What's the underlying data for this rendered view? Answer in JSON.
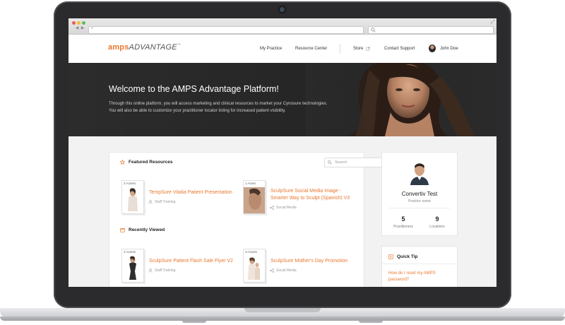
{
  "browser": {
    "url_value": "",
    "search_value": "",
    "back": "◀",
    "forward": "▶",
    "expand": "⤢"
  },
  "logo": {
    "brand": "amps",
    "product": "ADVANTAGE",
    "tm": "™"
  },
  "nav": {
    "my_practice": "My Practice",
    "resource_center": "Resource Center",
    "store": "Store",
    "store_icon": "external-link-icon",
    "contact_support": "Contact Support",
    "user_name": "John Doe"
  },
  "hero": {
    "title": "Welcome to the AMPS Advantage Platform!",
    "text": "Through this online platform, you will access marketing and clinical resources to market your Cynosure technologies. You will also be able to customize your practitioner locator listing for increased patient visibility."
  },
  "featured": {
    "title": "Featured Resources",
    "search_placeholder": "Search",
    "items": [
      {
        "count": "3 Assets",
        "title": "TempSure Vitalia Patient Presentation",
        "meta": "Staff Training",
        "meta_icon": "user-icon"
      },
      {
        "count": "1 Asset",
        "title": "SculpSure Social Media Image - Smarter Way to Sculpt (Spanish) V3",
        "meta": "Social Media",
        "meta_icon": "share-icon"
      }
    ]
  },
  "recent": {
    "title": "Recently Viewed",
    "items": [
      {
        "count": "3 Assets",
        "title": "SculpSure Patient Flash Sale Flyer V2",
        "meta": "Staff Training",
        "meta_icon": "user-icon"
      },
      {
        "count": "3 Assets",
        "title": "SculpSure Mother's Day Promotion",
        "meta": "Social Media",
        "meta_icon": "share-icon"
      }
    ]
  },
  "profile": {
    "name": "Convertiv Test",
    "subtitle": "Practice name",
    "practitioners_count": "5",
    "practitioners_label": "Practitioners",
    "locations_count": "9",
    "locations_label": "Locations"
  },
  "quick_tip": {
    "title": "Quick Tip",
    "question": "How do I reset my AMPS password?"
  },
  "colors": {
    "accent": "#e8772e",
    "hero_bg": "#2a2a2a",
    "page_bg": "#f2f2f2"
  }
}
